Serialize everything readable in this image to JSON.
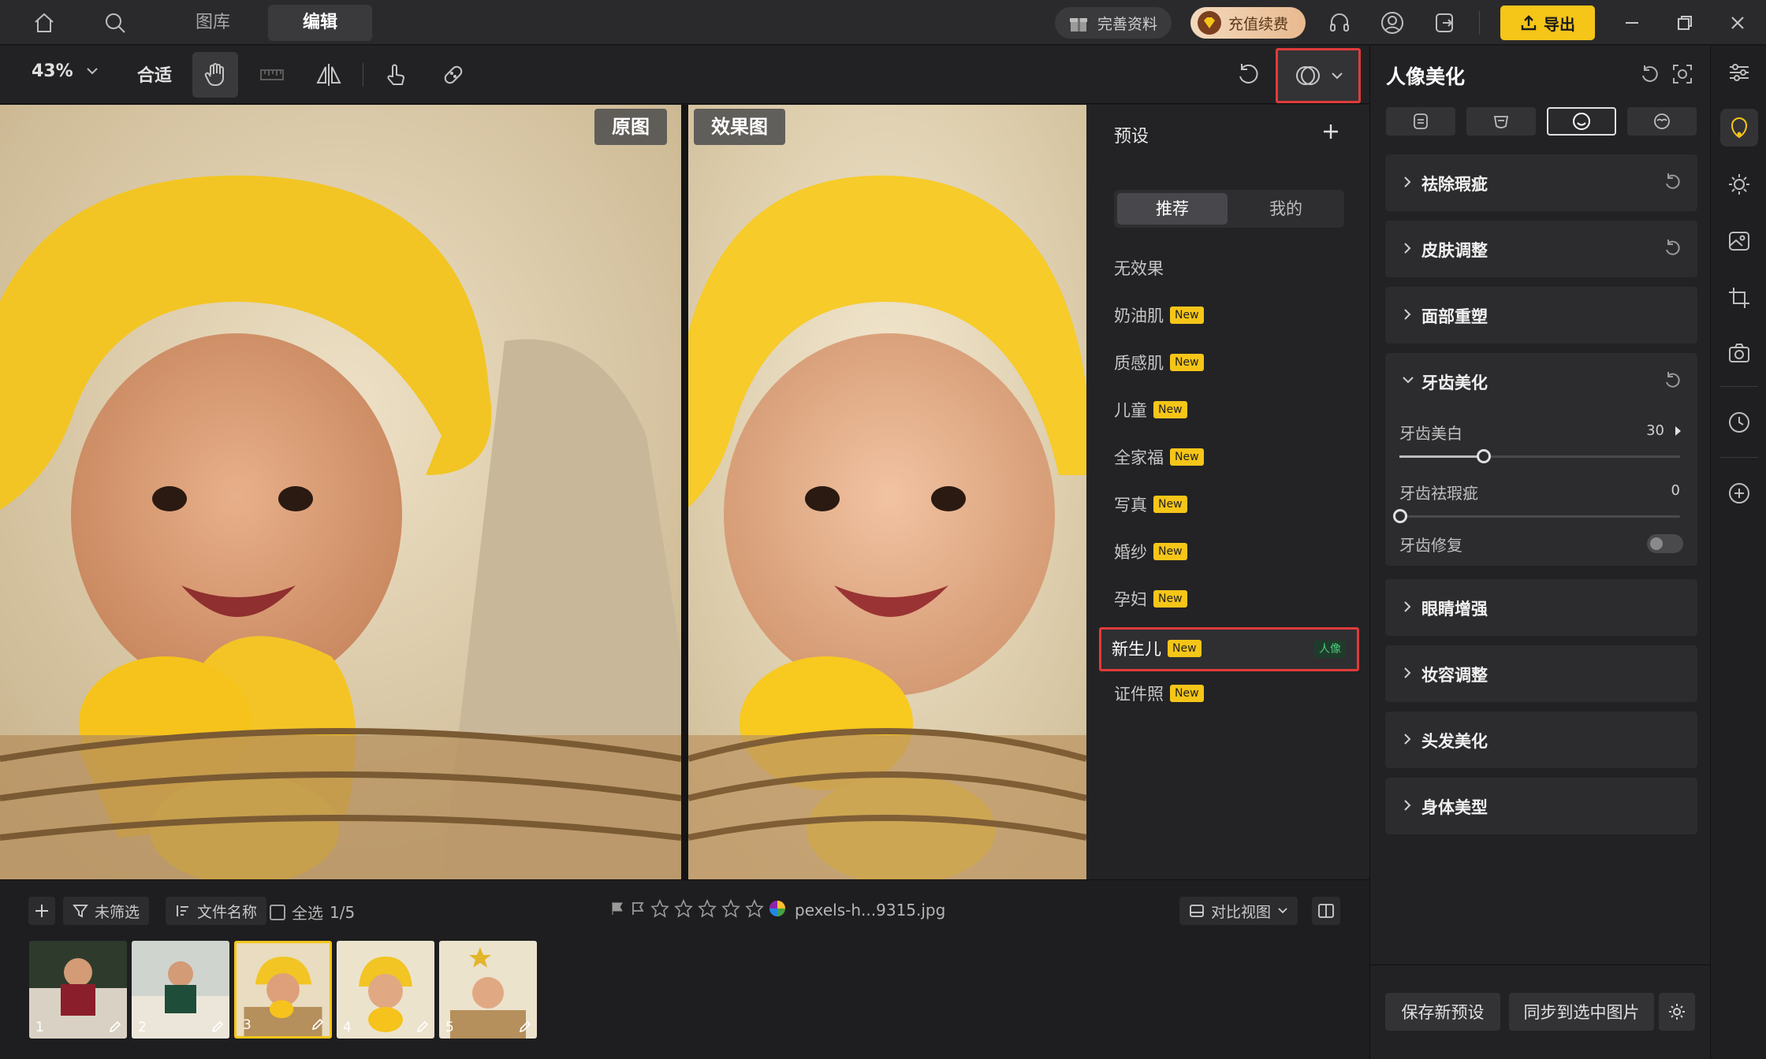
{
  "header": {
    "tabs": [
      {
        "label": "图库"
      },
      {
        "label": "编辑"
      }
    ],
    "active_tab": "编辑",
    "profile_label": "完善资料",
    "recharge_label": "充值续费",
    "export_label": "导出"
  },
  "toolbar": {
    "zoom": "43%",
    "fit_label": "合适"
  },
  "canvas": {
    "original_label": "原图",
    "effect_label": "效果图"
  },
  "presets": {
    "title": "预设",
    "tabs": [
      "推荐",
      "我的"
    ],
    "active_tab": "推荐",
    "items": [
      {
        "name": "无效果",
        "badge": ""
      },
      {
        "name": "奶油肌",
        "badge": "New"
      },
      {
        "name": "质感肌",
        "badge": "New"
      },
      {
        "name": "儿童",
        "badge": "New"
      },
      {
        "name": "全家福",
        "badge": "New"
      },
      {
        "name": "写真",
        "badge": "New"
      },
      {
        "name": "婚纱",
        "badge": "New"
      },
      {
        "name": "孕妇",
        "badge": "New"
      },
      {
        "name": "新生儿",
        "badge": "New",
        "tag": "人像",
        "selected": true
      },
      {
        "name": "证件照",
        "badge": "New"
      }
    ]
  },
  "filmstrip": {
    "filter_label": "未筛选",
    "sort_label": "文件名称",
    "select_all_label": "全选",
    "count": "1/5",
    "filename": "pexels-h...9315.jpg",
    "view_label": "对比视图",
    "thumbs": [
      {
        "num": "1"
      },
      {
        "num": "2"
      },
      {
        "num": "3",
        "selected": true
      },
      {
        "num": "4"
      },
      {
        "num": "5"
      }
    ]
  },
  "right_panel": {
    "title": "人像美化",
    "sections": [
      {
        "label": "祛除瑕疵",
        "has_reset": true
      },
      {
        "label": "皮肤调整",
        "has_reset": true
      },
      {
        "label": "面部重塑",
        "has_reset": false
      },
      {
        "label": "牙齿美化",
        "has_reset": true,
        "expanded": true
      },
      {
        "label": "眼睛增强",
        "has_reset": false
      },
      {
        "label": "妆容调整",
        "has_reset": false
      },
      {
        "label": "头发美化",
        "has_reset": false
      },
      {
        "label": "身体美型",
        "has_reset": false
      }
    ],
    "teeth": {
      "whiten_label": "牙齿美白",
      "whiten_value": "30",
      "blemish_label": "牙齿祛瑕疵",
      "blemish_value": "0",
      "repair_label": "牙齿修复",
      "repair_on": false
    },
    "save_preset_label": "保存新预设",
    "sync_label": "同步到选中图片"
  },
  "colors": {
    "accent": "#f5c518",
    "highlight_border": "#e03b3b",
    "portrait_tag": "#4cc97a"
  }
}
